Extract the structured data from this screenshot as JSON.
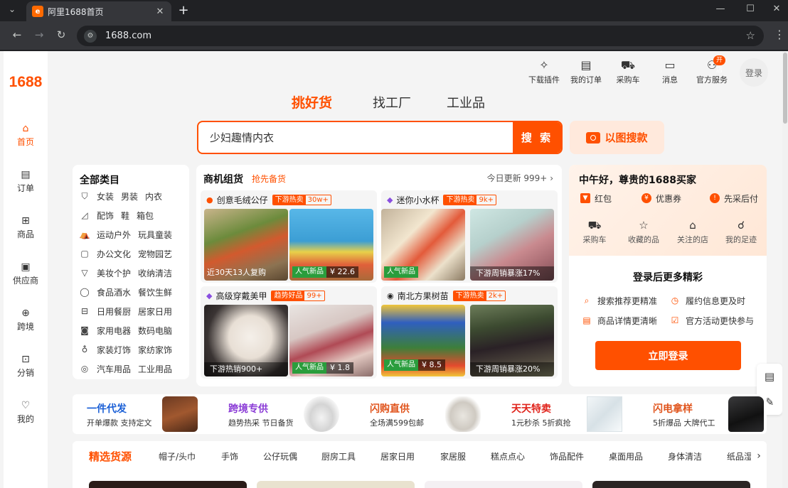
{
  "browser": {
    "tab_title": "阿里1688首页",
    "tab_favicon": "1688",
    "url": "1688.com"
  },
  "sidebar": {
    "logo": "1688",
    "items": [
      {
        "label": "首页",
        "icon": "home-icon",
        "active": true
      },
      {
        "label": "订单",
        "icon": "order-icon"
      },
      {
        "label": "商品",
        "icon": "grid-icon"
      },
      {
        "label": "供应商",
        "icon": "supplier-icon"
      },
      {
        "label": "跨境",
        "icon": "globe-icon"
      },
      {
        "label": "分销",
        "icon": "distribute-icon"
      },
      {
        "label": "我的",
        "icon": "heart-icon"
      }
    ]
  },
  "header": {
    "items": [
      {
        "label": "下载插件",
        "icon": "puzzle-icon"
      },
      {
        "label": "我的订单",
        "icon": "clipboard-icon"
      },
      {
        "label": "采购车",
        "icon": "cart-icon"
      },
      {
        "label": "消息",
        "icon": "message-icon"
      },
      {
        "label": "官方服务",
        "icon": "user-icon"
      }
    ],
    "open_badge": "开店",
    "login": "登录"
  },
  "search": {
    "tabs": [
      "挑好货",
      "找工厂",
      "工业品"
    ],
    "active_tab": "挑好货",
    "query": "少妇趣情内衣",
    "button": "搜 索",
    "image_search": "以图搜款",
    "accent": "#ff5000"
  },
  "categories": {
    "title": "全部类目",
    "rows": [
      {
        "icon": "shirt-icon",
        "links": [
          "女装",
          "男装",
          "内衣"
        ]
      },
      {
        "icon": "shoe-icon",
        "links": [
          "配饰",
          "鞋",
          "箱包"
        ]
      },
      {
        "icon": "tent-icon",
        "links": [
          "运动户外",
          "玩具童装"
        ]
      },
      {
        "icon": "briefcase-icon",
        "links": [
          "办公文化",
          "宠物园艺"
        ]
      },
      {
        "icon": "cup-icon",
        "links": [
          "美妆个护",
          "收纳清洁"
        ]
      },
      {
        "icon": "apple-icon",
        "links": [
          "食品酒水",
          "餐饮生鲜"
        ]
      },
      {
        "icon": "cabinet-icon",
        "links": [
          "日用餐厨",
          "居家日用"
        ]
      },
      {
        "icon": "camera-icon",
        "links": [
          "家用电器",
          "数码电脑"
        ]
      },
      {
        "icon": "bulb-icon",
        "links": [
          "家装灯饰",
          "家纺家饰"
        ]
      },
      {
        "icon": "tire-icon",
        "links": [
          "汽车用品",
          "工业用品"
        ]
      }
    ]
  },
  "business": {
    "title": "商机组货",
    "subtitle": "抢先备货",
    "update": "今日更新 999+",
    "cards": [
      {
        "title": "创意毛绒公仔",
        "tag": "下游热卖",
        "tag_value": "30w+",
        "products": [
          {
            "caption": "近30天13人复购"
          },
          {
            "badge": "人气新品",
            "price": "¥ 22.6"
          }
        ]
      },
      {
        "title": "迷你小水杯",
        "tag": "下游热卖",
        "tag_value": "9k+",
        "products": [
          {
            "badge": "人气新品"
          },
          {
            "caption": "下游周销暴涨17%"
          }
        ]
      },
      {
        "title": "高级穿戴美甲",
        "tag": "趋势好品",
        "tag_value": "99+",
        "products": [
          {
            "caption": "下游热销900+"
          },
          {
            "badge": "人气新品",
            "price": "¥ 1.8"
          }
        ]
      },
      {
        "title": "南北方果树苗",
        "tag": "下游热卖",
        "tag_value": "2k+",
        "products": [
          {
            "badge": "人气新品",
            "price": "¥ 8.5"
          },
          {
            "caption": "下游周销暴涨20%"
          }
        ]
      }
    ]
  },
  "user_panel": {
    "greeting": "中午好，尊贵的1688买家",
    "perks": [
      "红包",
      "优惠券",
      "先采后付"
    ],
    "quick_links": [
      {
        "label": "采购车",
        "icon": "cart-icon"
      },
      {
        "label": "收藏的品",
        "icon": "star-icon"
      },
      {
        "label": "关注的店",
        "icon": "shop-icon"
      },
      {
        "label": "我的足迹",
        "icon": "footprint-icon"
      }
    ],
    "login_more": "登录后更多精彩",
    "features": [
      "搜索推荐更精准",
      "履约信息更及时",
      "商品详情更清晰",
      "官方活动更快参与"
    ],
    "login_button": "立即登录"
  },
  "promos": [
    {
      "title": "一件代发",
      "sub": "开单爆款 支持定文",
      "color": "#1a5fd6"
    },
    {
      "title": "跨境专供",
      "sub": "趋势热采 节日备货",
      "color": "#8a3bd6"
    },
    {
      "title": "闪购直供",
      "sub": "全场满599包邮",
      "color": "#e0541c"
    },
    {
      "title": "天天特卖",
      "sub": "1元秒杀 5折疯抢",
      "color": "#e0241c"
    },
    {
      "title": "闪电拿样",
      "sub": "5折爆品 大牌代工",
      "color": "#e0541c"
    }
  ],
  "catnav": {
    "title": "精选货源",
    "items": [
      "帽子/头巾",
      "手饰",
      "公仔玩偶",
      "厨房工具",
      "居家日用",
      "家居服",
      "糕点点心",
      "饰品配件",
      "桌面用品",
      "身体清洁",
      "纸品湿"
    ]
  }
}
